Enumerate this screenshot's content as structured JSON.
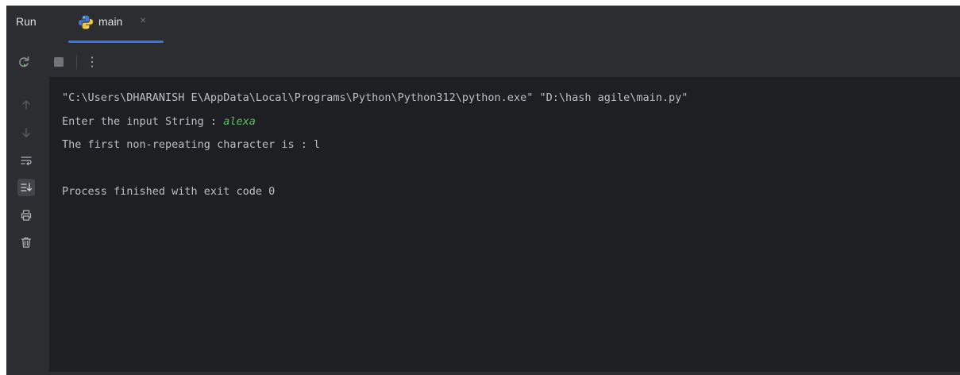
{
  "run_panel": {
    "title": "Run",
    "tab": {
      "label": "main",
      "close_glyph": "×",
      "icon": "python-icon"
    },
    "toolbar": {
      "rerun_icon": "rerun-icon",
      "stop_icon": "stop-icon",
      "more_icon": "more-vertical-icon",
      "more_glyph": "⋮"
    },
    "gutter": {
      "icons": [
        "arrow-up-icon",
        "arrow-down-icon",
        "soft-wrap-icon",
        "scroll-to-end-icon",
        "print-icon",
        "trash-icon"
      ]
    },
    "console": {
      "command_line": "\"C:\\Users\\DHARANISH E\\AppData\\Local\\Programs\\Python\\Python312\\python.exe\" \"D:\\hash agile\\main.py\"",
      "prompt_text": "Enter the input String : ",
      "user_input": "alexa",
      "output_line": "The first non-repeating character is : l",
      "exit_message": "Process finished with exit code 0"
    },
    "colors": {
      "accent": "#3574f0",
      "panel_bg": "#2b2d30",
      "console_bg": "#1e1f22",
      "text": "#bcbec4",
      "input_text": "#5fb865"
    }
  }
}
